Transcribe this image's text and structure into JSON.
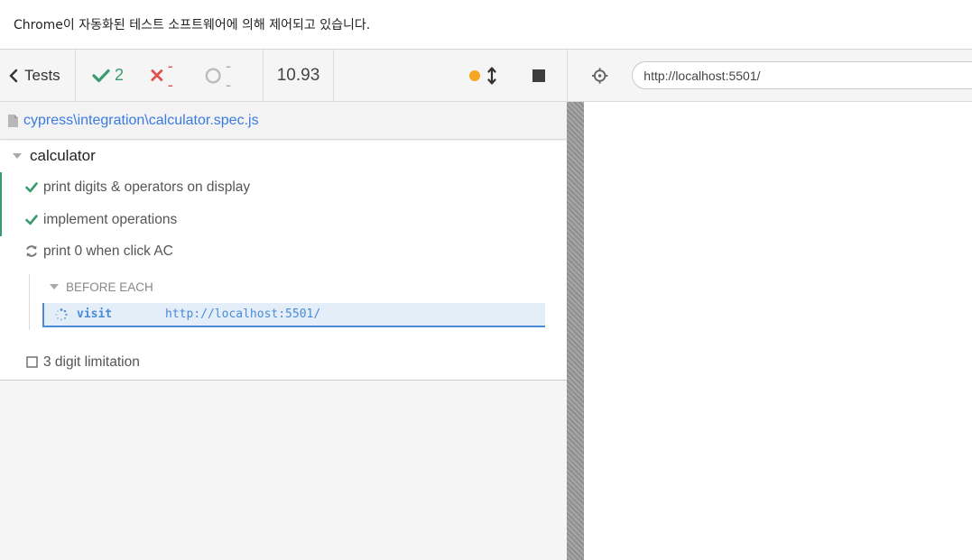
{
  "infobar": {
    "text": "Chrome이 자동화된 테스트 소프트웨어에 의해 제어되고 있습니다."
  },
  "toolbar": {
    "tests_label": "Tests",
    "passed": "2",
    "failed": "--",
    "pending": "--",
    "duration": "10.93",
    "colors": {
      "pass": "#3a9b6e",
      "fail": "#e05050",
      "running_dot": "#f5a623"
    }
  },
  "url": {
    "value": "http://localhost:5501/"
  },
  "spec": {
    "path": "cypress\\integration\\calculator.spec.js"
  },
  "runnables": {
    "suite_title": "calculator",
    "tests": [
      {
        "title": "print digits & operators on display",
        "state": "passed",
        "icon": "check-icon"
      },
      {
        "title": "implement operations",
        "state": "passed",
        "icon": "check-icon"
      },
      {
        "title": "print 0 when click AC",
        "state": "running",
        "icon": "refresh-icon"
      },
      {
        "title": "3 digit limitation",
        "state": "pending",
        "icon": "square-icon"
      }
    ],
    "hook": {
      "title": "BEFORE EACH",
      "command_name": "visit",
      "command_message": "http://localhost:5501/"
    }
  }
}
